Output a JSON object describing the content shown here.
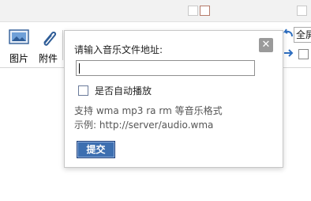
{
  "toolbar": {
    "image_label": "图片",
    "attachment_label": "附件",
    "fullscreen_label": "全屏"
  },
  "dialog": {
    "prompt": "请输入音乐文件地址:",
    "url_value": "",
    "url_placeholder": "",
    "autoplay_label": "是否自动播放",
    "autoplay_checked": false,
    "support_text": "支持 wma mp3 ra rm 等音乐格式",
    "example_text": "示例: http://server/audio.wma",
    "submit_label": "提交",
    "close_symbol": "✕"
  },
  "colors": {
    "submit_bg": "#3d6fb0",
    "close_bg": "#9a9a9a",
    "dialog_border": "#c7c7c7"
  }
}
